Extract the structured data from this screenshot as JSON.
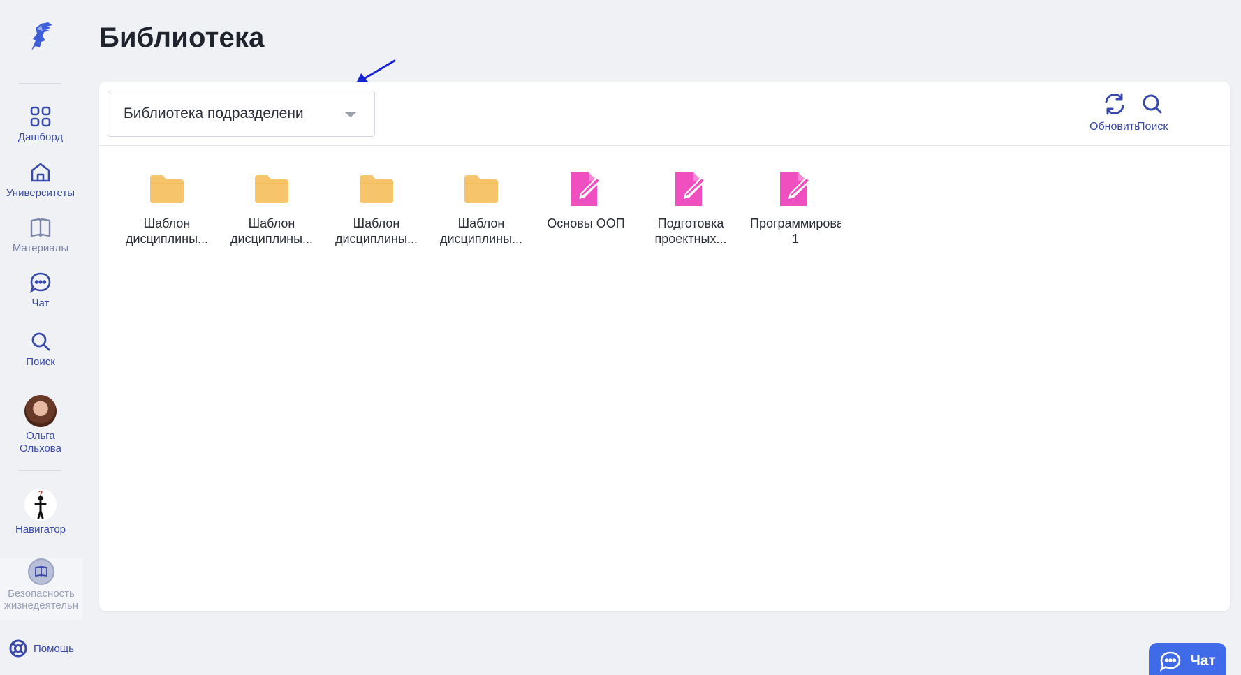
{
  "sidebar": {
    "items": [
      {
        "label": "Дашборд",
        "icon": "grid-icon"
      },
      {
        "label": "Университеты",
        "icon": "university-icon"
      },
      {
        "label": "Материалы",
        "icon": "book-icon"
      },
      {
        "label": "Чат",
        "icon": "chat-icon"
      },
      {
        "label": "Поиск",
        "icon": "search-icon"
      }
    ],
    "user": {
      "label": "Ольга Ольхова"
    },
    "navigator": {
      "label": "Навигатор"
    },
    "course": {
      "label": "Безопасность жизнедеятельн"
    },
    "help": {
      "label": "Помощь"
    }
  },
  "page": {
    "title": "Библиотека"
  },
  "library": {
    "select_value": "Библиотека подразделени",
    "refresh_label": "Обновить",
    "search_label": "Поиск",
    "items": [
      {
        "type": "folder",
        "name": "Шаблон дисциплины..."
      },
      {
        "type": "folder",
        "name": "Шаблон дисциплины..."
      },
      {
        "type": "folder",
        "name": "Шаблон дисциплины..."
      },
      {
        "type": "folder",
        "name": "Шаблон дисциплины..."
      },
      {
        "type": "document",
        "name": "Основы ООП"
      },
      {
        "type": "document",
        "name": "Подготовка проектных..."
      },
      {
        "type": "document",
        "name": "Программирова 1"
      }
    ]
  },
  "chat_fab": {
    "label": "Чат"
  },
  "colors": {
    "accent": "#3949ab",
    "folder": "#f6c56b",
    "document": "#f04fbf",
    "fab": "#3f6ae8"
  }
}
